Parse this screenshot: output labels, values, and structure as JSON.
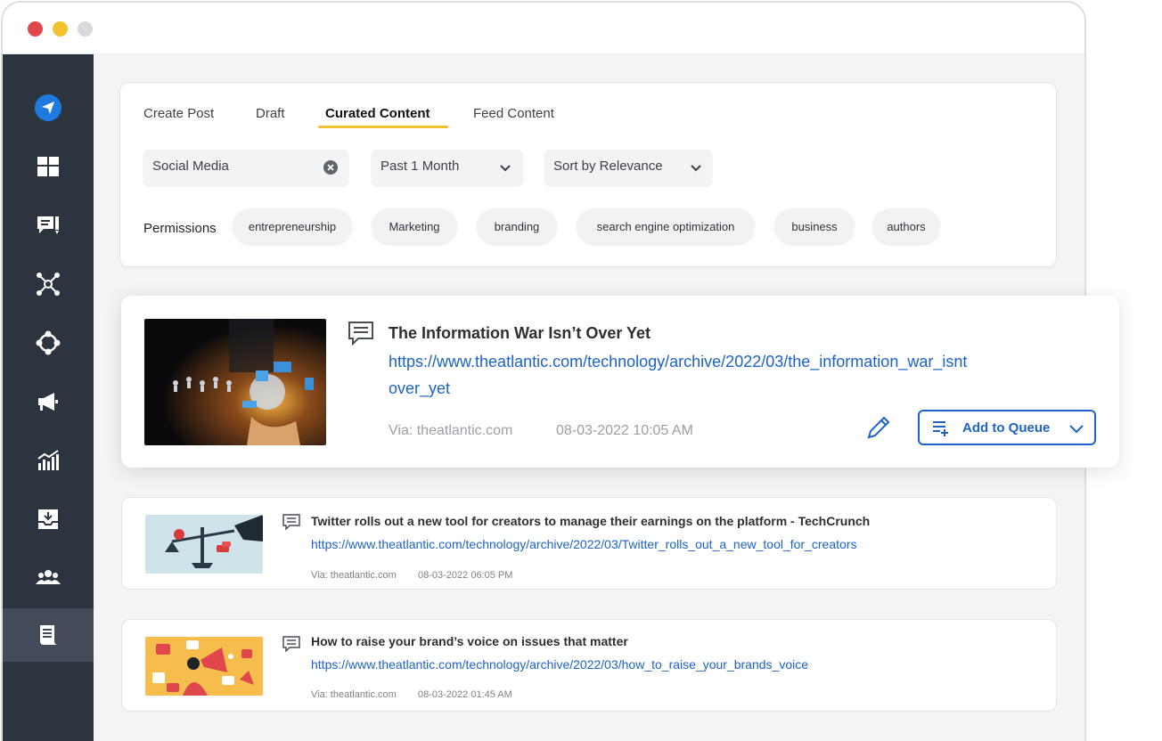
{
  "sidebar": {
    "items": [
      {
        "icon": "send-logo-icon"
      },
      {
        "icon": "dashboard-icon"
      },
      {
        "icon": "compose-icon"
      },
      {
        "icon": "network-icon"
      },
      {
        "icon": "connections-icon"
      },
      {
        "icon": "megaphone-icon"
      },
      {
        "icon": "analytics-icon"
      },
      {
        "icon": "inbox-download-icon"
      },
      {
        "icon": "team-icon"
      },
      {
        "icon": "content-list-icon"
      }
    ],
    "active_index": 9
  },
  "tabs": [
    "Create Post",
    "Draft",
    "Curated Content",
    "Feed Content"
  ],
  "active_tab": "Curated Content",
  "filters": {
    "search_value": "Social Media",
    "time_range": "Past 1 Month",
    "sort": "Sort by Relevance"
  },
  "permissions": {
    "label": "Permissions",
    "chips": [
      "entrepreneurship",
      "Marketing",
      "branding",
      "search engine optimization",
      "business",
      "authors"
    ]
  },
  "featured": {
    "title": "The Information War Isn’t Over Yet",
    "url_line1": "https://www.theatlantic.com/technology/archive/2022/03/the_information_war_isnt",
    "url_line2": "over_yet",
    "via": "Via: theatlantic.com",
    "date": "08-03-2022 10:05 AM",
    "queue_label": "Add to Queue"
  },
  "posts": [
    {
      "title": "Twitter rolls out a new tool for creators to manage their earnings on the platform - TechCrunch",
      "url": "https://www.theatlantic.com/technology/archive/2022/03/Twitter_rolls_out_a_new_tool_for_creators",
      "via": "Via: theatlantic.com",
      "date": "08-03-2022 06:05 PM"
    },
    {
      "title": "How to raise your brand’s voice on issues that matter",
      "url": "https://www.theatlantic.com/technology/archive/2022/03/how_to_raise_your_brands_voice",
      "via": "Via: theatlantic.com",
      "date": "08-03-2022 01:45 AM"
    }
  ],
  "colors": {
    "sidebar_bg": "#2c3440",
    "accent_blue": "#1f63c6",
    "tab_underline": "#f2c230"
  }
}
